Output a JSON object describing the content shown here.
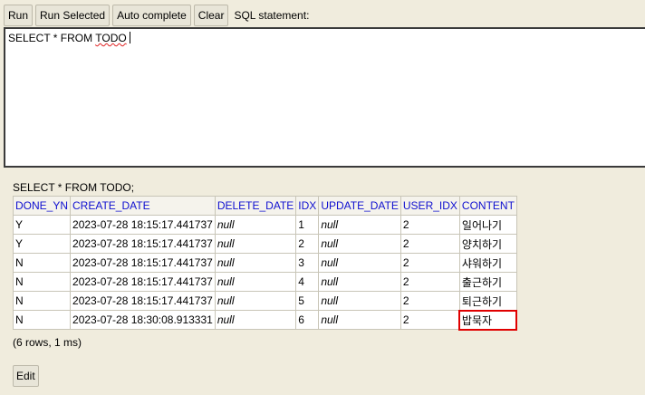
{
  "toolbar": {
    "run_label": "Run",
    "run_selected_label": "Run Selected",
    "auto_complete_label": "Auto complete",
    "clear_label": "Clear",
    "sql_statement_label": "SQL statement:"
  },
  "editor": {
    "prefix": "SELECT * FROM ",
    "table_word": "TODO"
  },
  "result": {
    "query": "SELECT * FROM TODO;",
    "columns": [
      "DONE_YN",
      "CREATE_DATE",
      "DELETE_DATE",
      "IDX",
      "UPDATE_DATE",
      "USER_IDX",
      "CONTENT"
    ],
    "rows": [
      [
        "Y",
        "2023-07-28 18:15:17.441737",
        "null",
        "1",
        "null",
        "2",
        "일어나기"
      ],
      [
        "Y",
        "2023-07-28 18:15:17.441737",
        "null",
        "2",
        "null",
        "2",
        "양치하기"
      ],
      [
        "N",
        "2023-07-28 18:15:17.441737",
        "null",
        "3",
        "null",
        "2",
        "샤워하기"
      ],
      [
        "N",
        "2023-07-28 18:15:17.441737",
        "null",
        "4",
        "null",
        "2",
        "출근하기"
      ],
      [
        "N",
        "2023-07-28 18:15:17.441737",
        "null",
        "5",
        "null",
        "2",
        "퇴근하기"
      ],
      [
        "N",
        "2023-07-28 18:30:08.913331",
        "null",
        "6",
        "null",
        "2",
        "밥묵자"
      ]
    ],
    "row_count": "(6 rows, 1 ms)",
    "edit_label": "Edit"
  },
  "colors": {
    "background": "#f0ecdd",
    "header_text": "#1010d0",
    "highlight_border": "#e00000"
  }
}
